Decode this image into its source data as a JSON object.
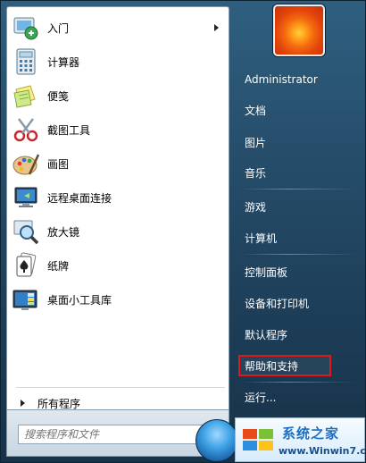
{
  "programs": [
    {
      "label": "入门",
      "icon": "getting-started-icon",
      "has_submenu": true
    },
    {
      "label": "计算器",
      "icon": "calculator-icon"
    },
    {
      "label": "便笺",
      "icon": "sticky-notes-icon"
    },
    {
      "label": "截图工具",
      "icon": "snipping-tool-icon"
    },
    {
      "label": "画图",
      "icon": "paint-icon"
    },
    {
      "label": "远程桌面连接",
      "icon": "remote-desktop-icon"
    },
    {
      "label": "放大镜",
      "icon": "magnifier-icon"
    },
    {
      "label": "纸牌",
      "icon": "solitaire-icon"
    },
    {
      "label": "桌面小工具库",
      "icon": "gadgets-icon"
    }
  ],
  "all_programs_label": "所有程序",
  "search": {
    "placeholder": "搜索程序和文件"
  },
  "right_items": [
    {
      "label": "Administrator"
    },
    {
      "label": "文档"
    },
    {
      "label": "图片"
    },
    {
      "label": "音乐"
    },
    {
      "label": "游戏"
    },
    {
      "label": "计算机"
    },
    {
      "label": "控制面板"
    },
    {
      "label": "设备和打印机"
    },
    {
      "label": "默认程序"
    },
    {
      "label": "帮助和支持",
      "highlighted": true
    },
    {
      "label": "运行..."
    }
  ],
  "watermark": {
    "title": "系统之家",
    "url": "www.Winwin7.com"
  },
  "colors": {
    "highlight_border": "#e01818",
    "menu_bg": "#254d6a"
  }
}
